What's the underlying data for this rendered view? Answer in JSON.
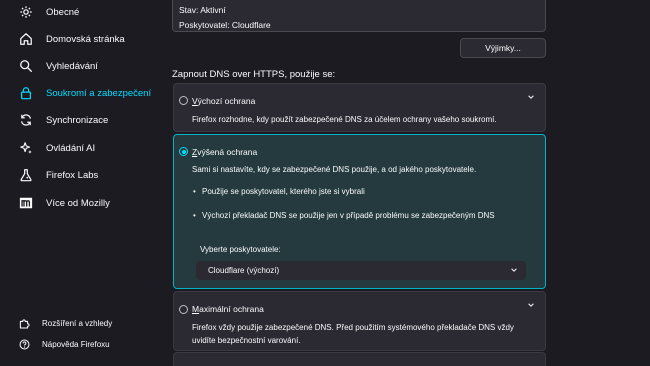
{
  "sidebar": {
    "items": [
      {
        "label": "Obecné",
        "icon": "gear-icon"
      },
      {
        "label": "Domovská stránka",
        "icon": "home-icon"
      },
      {
        "label": "Vyhledávání",
        "icon": "search-icon"
      },
      {
        "label": "Soukromí a zabezpečení",
        "icon": "lock-icon",
        "active": true
      },
      {
        "label": "Synchronizace",
        "icon": "sync-icon"
      },
      {
        "label": "Ovládání AI",
        "icon": "sparkle-icon"
      },
      {
        "label": "Firefox Labs",
        "icon": "flask-icon"
      },
      {
        "label": "Více od Mozilly",
        "icon": "mozilla-m-icon"
      }
    ],
    "bottom_links": [
      {
        "label": "Rozšíření a vzhledy",
        "icon": "puzzle-icon"
      },
      {
        "label": "Nápověda Firefoxu",
        "icon": "help-icon"
      }
    ]
  },
  "status": {
    "state": "Stav: Aktivní",
    "provider": "Poskytovatel: Cloudflare"
  },
  "exceptions_button": "Výjimky...",
  "section_title": "Zapnout DNS over HTTPS, použije se:",
  "options": {
    "default": {
      "title_access": "V",
      "title_rest": "ýchozí ochrana",
      "description": "Firefox rozhodne, kdy použít zabezpečené DNS za účelem ochrany vašeho soukromí."
    },
    "increased": {
      "title_access": "Z",
      "title_rest": "výšená ochrana",
      "description": "Sami si nastavíte, kdy se zabezpečené DNS použije, a od jakého poskytovatele.",
      "bullets": [
        "Použije se poskytovatel, kterého jste si vybrali",
        "Výchozí překladač DNS se použije jen v případě problému se zabezpečeným DNS"
      ],
      "provider_label": "Vyberte poskytovatele:",
      "provider_value": "Cloudflare (výchozí)"
    },
    "max": {
      "title_access": "M",
      "title_rest": "aximální ochrana",
      "description_line1": "Firefox vždy použije zabezpečené DNS. Před použitím systémového překladače DNS vždy",
      "description_line2": "uvidíte bezpečnostní varování."
    }
  },
  "colors": {
    "accent": "#00ddff",
    "background": "#1c1b22",
    "card": "#2b2a33",
    "selected_card": "#243a3f"
  }
}
